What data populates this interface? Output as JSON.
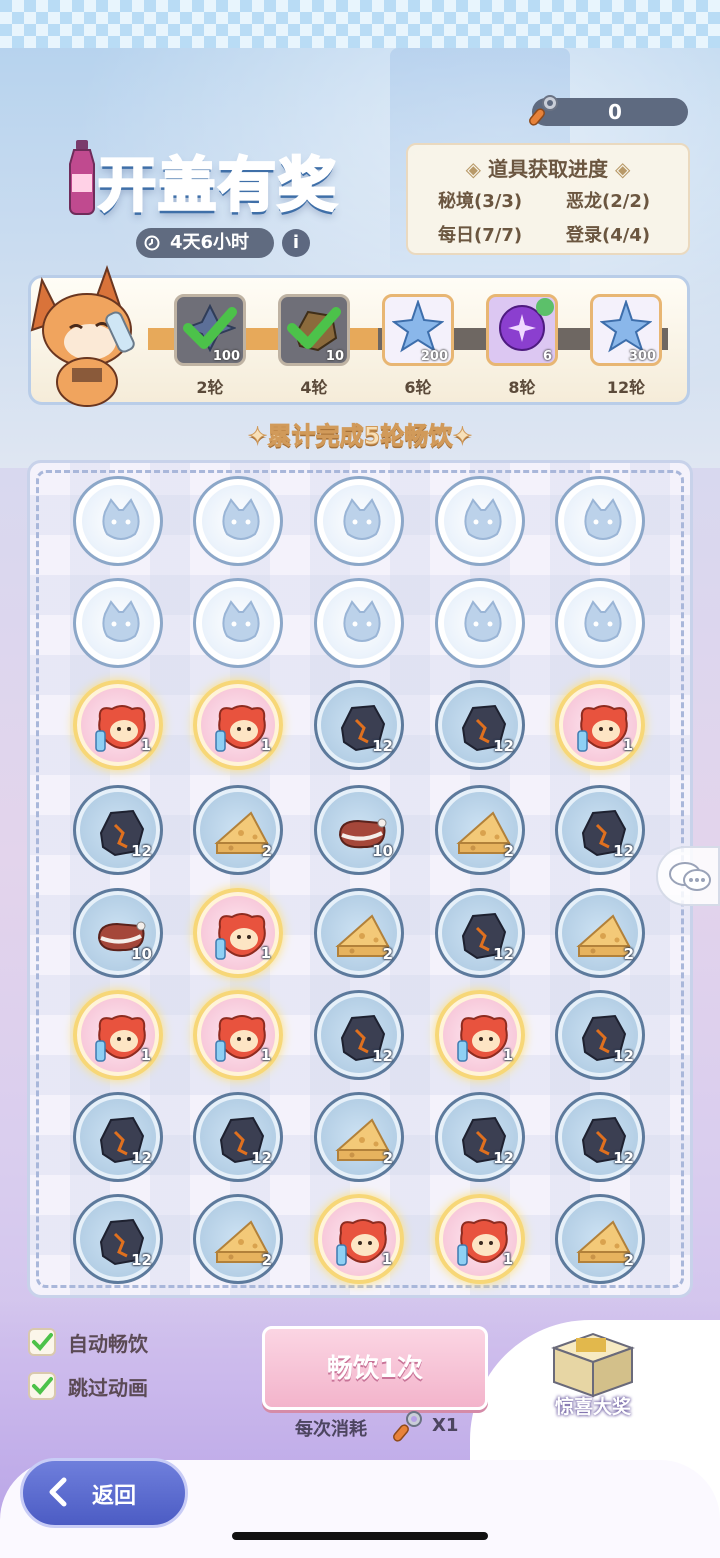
{
  "header": {
    "key_count": "0",
    "title": "开盖有奖",
    "timer": "4天6小时",
    "info_symbol": "i"
  },
  "progress_panel": {
    "title": "道具获取进度",
    "items": [
      "秘境(3/3)",
      "恶龙(2/2)",
      "每日(7/7)",
      "登录(4/4)"
    ]
  },
  "milestones": [
    {
      "label": "2轮",
      "qty": "100",
      "item": "dark-crystal",
      "claimed": true
    },
    {
      "label": "4轮",
      "qty": "10",
      "item": "ore",
      "claimed": true
    },
    {
      "label": "6轮",
      "qty": "200",
      "item": "blue-star-crystal",
      "claimed": false
    },
    {
      "label": "8轮",
      "qty": "6",
      "item": "purple-orb",
      "claimed": false
    },
    {
      "label": "12轮",
      "qty": "300",
      "item": "blue-star-crystal",
      "claimed": false
    }
  ],
  "subtitle": "累计完成5轮畅饮",
  "board": {
    "rows": [
      [
        {
          "t": "empty",
          "q": ""
        },
        {
          "t": "empty",
          "q": ""
        },
        {
          "t": "empty",
          "q": ""
        },
        {
          "t": "empty",
          "q": ""
        },
        {
          "t": "empty",
          "q": ""
        }
      ],
      [
        {
          "t": "empty",
          "q": ""
        },
        {
          "t": "empty",
          "q": ""
        },
        {
          "t": "empty",
          "q": ""
        },
        {
          "t": "empty",
          "q": ""
        },
        {
          "t": "empty",
          "q": ""
        }
      ],
      [
        {
          "t": "cat",
          "q": "1"
        },
        {
          "t": "cat",
          "q": "1"
        },
        {
          "t": "coal",
          "q": "12"
        },
        {
          "t": "coal",
          "q": "12"
        },
        {
          "t": "cat",
          "q": "1"
        }
      ],
      [
        {
          "t": "coal",
          "q": "12"
        },
        {
          "t": "cheese",
          "q": "2"
        },
        {
          "t": "meat",
          "q": "10"
        },
        {
          "t": "cheese",
          "q": "2"
        },
        {
          "t": "coal",
          "q": "12"
        }
      ],
      [
        {
          "t": "meat",
          "q": "10"
        },
        {
          "t": "cat",
          "q": "1"
        },
        {
          "t": "cheese",
          "q": "2"
        },
        {
          "t": "coal",
          "q": "12"
        },
        {
          "t": "cheese",
          "q": "2"
        }
      ],
      [
        {
          "t": "cat",
          "q": "1"
        },
        {
          "t": "cat",
          "q": "1"
        },
        {
          "t": "coal",
          "q": "12"
        },
        {
          "t": "cat",
          "q": "1"
        },
        {
          "t": "coal",
          "q": "12"
        }
      ],
      [
        {
          "t": "coal",
          "q": "12"
        },
        {
          "t": "coal",
          "q": "12"
        },
        {
          "t": "cheese",
          "q": "2"
        },
        {
          "t": "coal",
          "q": "12"
        },
        {
          "t": "coal",
          "q": "12"
        }
      ],
      [
        {
          "t": "coal",
          "q": "12"
        },
        {
          "t": "cheese",
          "q": "2"
        },
        {
          "t": "cat",
          "q": "1"
        },
        {
          "t": "cat",
          "q": "1"
        },
        {
          "t": "cheese",
          "q": "2"
        }
      ]
    ]
  },
  "controls": {
    "auto_drink": "自动畅饮",
    "skip_anim": "跳过动画",
    "drink_button": "畅饮1次",
    "cost_label": "每次消耗",
    "cost_qty": "X1",
    "prize_label": "惊喜大奖",
    "back_label": "返回"
  },
  "colors": {
    "title_blue": "#6fb3ea",
    "check_green": "#4cc24a",
    "track_done": "#e7a95a",
    "button_pink": "#f3b4cb",
    "back_blue": "#4c5cc4"
  }
}
